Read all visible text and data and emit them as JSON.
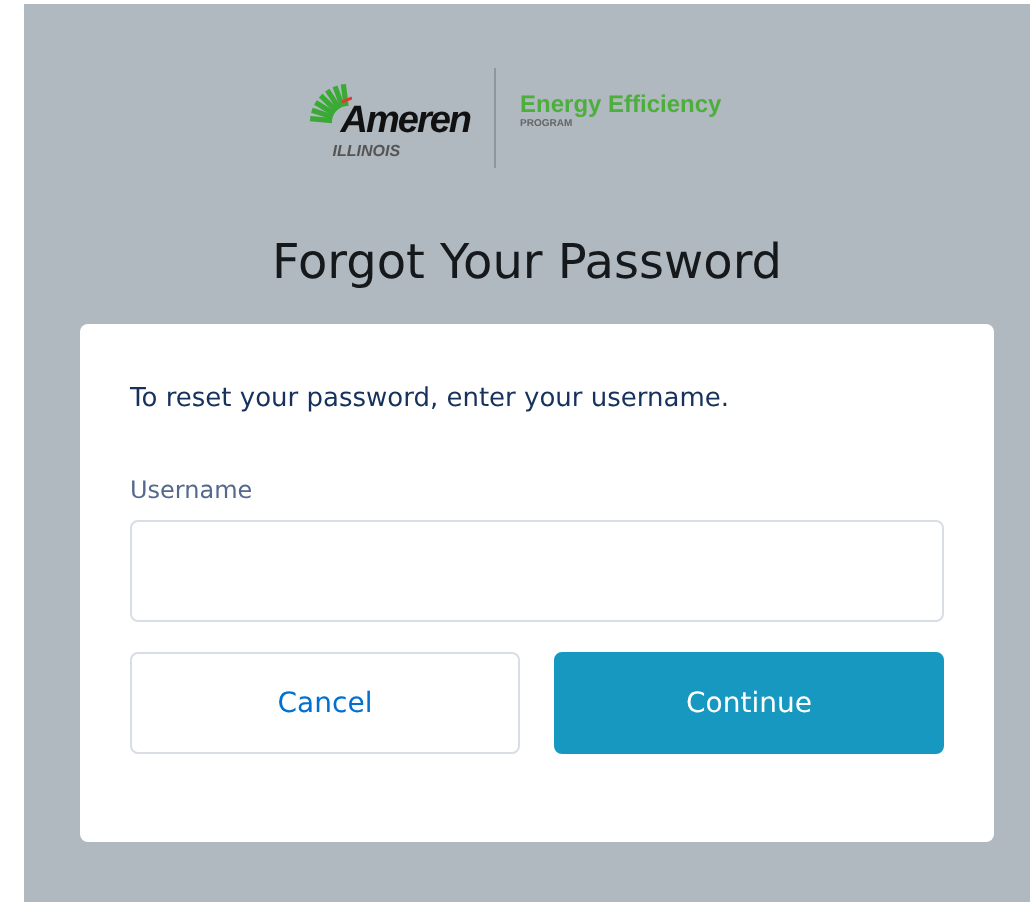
{
  "logo": {
    "brand": "Ameren",
    "region": "ILLINOIS",
    "program": "Energy Efficiency",
    "program_sub": "PROGRAM"
  },
  "title": "Forgot Your Password",
  "instructions": "To reset your password, enter your username.",
  "username": {
    "label": "Username"
  },
  "buttons": [
    {
      "label": "Cancel",
      "kind": "secondary"
    },
    {
      "label": "Continue",
      "kind": "primary"
    }
  ]
}
